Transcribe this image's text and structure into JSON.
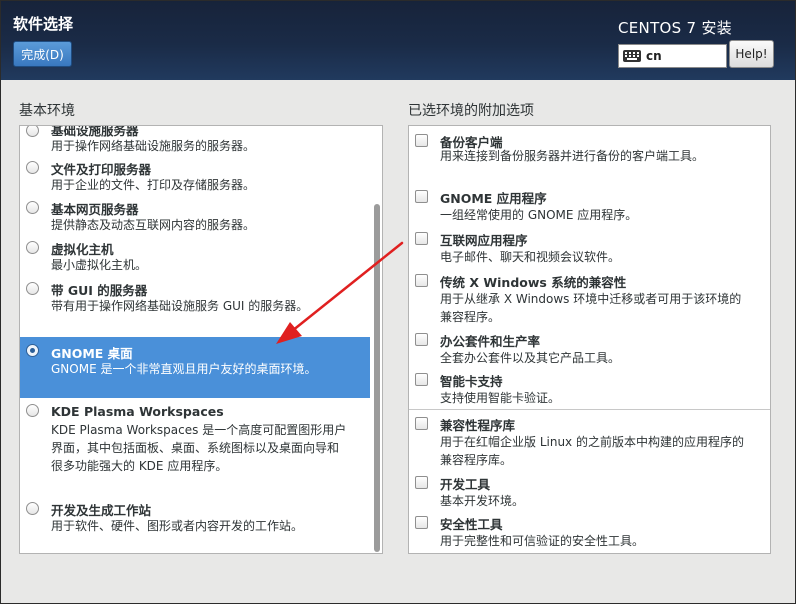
{
  "header": {
    "title": "软件选择",
    "done_label": "完成(D)",
    "installer_title": "CENTOS 7 安装",
    "keyboard_layout": "cn",
    "help_label": "Help!"
  },
  "base_env": {
    "title": "基本环境",
    "items": [
      {
        "name": "基础设施服务器",
        "desc": [
          "用于操作网络基础设施服务的服务器。"
        ],
        "selected": false
      },
      {
        "name": "文件及打印服务器",
        "desc": [
          "用于企业的文件、打印及存储服务器。"
        ],
        "selected": false
      },
      {
        "name": "基本网页服务器",
        "desc": [
          "提供静态及动态互联网内容的服务器。"
        ],
        "selected": false
      },
      {
        "name": "虚拟化主机",
        "desc": [
          "最小虚拟化主机。"
        ],
        "selected": false
      },
      {
        "name": "带 GUI 的服务器",
        "desc": [
          "带有用于操作网络基础设施服务 GUI 的服务器。"
        ],
        "selected": false
      },
      {
        "name": "GNOME 桌面",
        "desc": [
          "GNOME 是一个非常直观且用户友好的桌面环境。"
        ],
        "selected": true
      },
      {
        "name": "KDE Plasma Workspaces",
        "desc": [
          "KDE Plasma Workspaces 是一个高度可配置图形用户",
          "界面，其中包括面板、桌面、系统图标以及桌面向导和",
          "很多功能强大的 KDE 应用程序。"
        ],
        "selected": false
      },
      {
        "name": "开发及生成工作站",
        "desc": [
          "用于软件、硬件、图形或者内容开发的工作站。"
        ],
        "selected": false
      }
    ]
  },
  "addons": {
    "title": "已选环境的附加选项",
    "items": [
      {
        "name": "备份客户端",
        "desc": [
          "用来连接到备份服务器并进行备份的客户端工具。"
        ]
      },
      {
        "name": "GNOME 应用程序",
        "desc": [
          "一组经常使用的 GNOME 应用程序。"
        ]
      },
      {
        "name": "互联网应用程序",
        "desc": [
          "电子邮件、聊天和视频会议软件。"
        ]
      },
      {
        "name": "传统 X Windows 系统的兼容性",
        "desc": [
          "用于从继承 X Windows 环境中迁移或者可用于该环境的",
          "兼容程序。"
        ]
      },
      {
        "name": "办公套件和生产率",
        "desc": [
          "全套办公套件以及其它产品工具。"
        ]
      },
      {
        "name": "智能卡支持",
        "desc": [
          "支持使用智能卡验证。"
        ]
      },
      {
        "name": "兼容性程序库",
        "desc": [
          "用于在红帽企业版 Linux 的之前版本中构建的应用程序的",
          "兼容程序库。"
        ]
      },
      {
        "name": "开发工具",
        "desc": [
          "基本开发环境。"
        ]
      },
      {
        "name": "安全性工具",
        "desc": [
          "用于完整性和可信验证的安全性工具。"
        ]
      }
    ]
  },
  "colors": {
    "header_bg": "#1a2b47",
    "selection": "#4a90d9",
    "annotation_arrow": "#e02020"
  }
}
